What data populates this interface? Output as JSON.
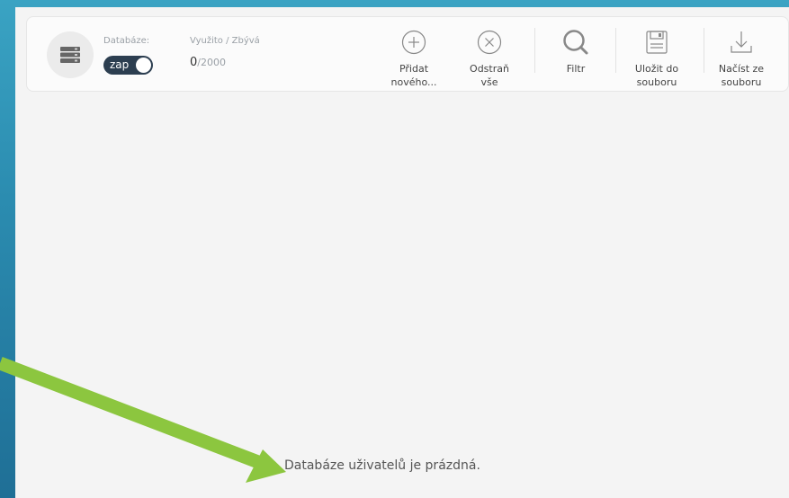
{
  "database": {
    "label": "Databáze:",
    "toggle_label": "zap"
  },
  "usage": {
    "label": "Využito / Zbývá",
    "used": "0",
    "total": "/2000"
  },
  "toolbar": {
    "add_label_1": "Přidat",
    "add_label_2": "nového...",
    "remove_label_1": "Odstraň",
    "remove_label_2": "vše",
    "filter_label": "Filtr",
    "save_label_1": "Uložit do",
    "save_label_2": "souboru",
    "load_label_1": "Načíst ze",
    "load_label_2": "souboru"
  },
  "empty_message": "Databáze uživatelů je prázdná.",
  "colors": {
    "toggle_bg": "#2c3e50",
    "arrow": "#8cc63f",
    "background": "#2b8cb0"
  }
}
